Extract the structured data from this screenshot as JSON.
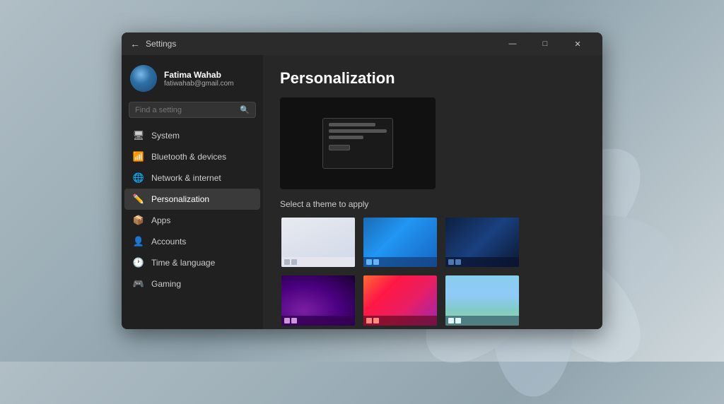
{
  "titlebar": {
    "back_label": "←",
    "title": "Settings",
    "minimize": "—",
    "maximize": "□",
    "close": "✕"
  },
  "sidebar": {
    "profile": {
      "name": "Fatima Wahab",
      "email": "fatiwahab@gmail.com"
    },
    "search": {
      "placeholder": "Find a setting"
    },
    "nav_items": [
      {
        "id": "system",
        "label": "System",
        "icon": "🖥"
      },
      {
        "id": "bluetooth",
        "label": "Bluetooth & devices",
        "icon": "📶"
      },
      {
        "id": "network",
        "label": "Network & internet",
        "icon": "🌐"
      },
      {
        "id": "personalization",
        "label": "Personalization",
        "icon": "✏️",
        "active": true
      },
      {
        "id": "apps",
        "label": "Apps",
        "icon": "📦"
      },
      {
        "id": "accounts",
        "label": "Accounts",
        "icon": "👤"
      },
      {
        "id": "time",
        "label": "Time & language",
        "icon": "🕐"
      },
      {
        "id": "gaming",
        "label": "Gaming",
        "icon": "🎮"
      }
    ]
  },
  "main": {
    "title": "Personalization",
    "section_label": "Select a theme to apply",
    "themes": [
      {
        "id": "light",
        "class": "theme-light"
      },
      {
        "id": "blue-bloom",
        "class": "theme-blue-bloom"
      },
      {
        "id": "dark-blue",
        "class": "theme-dark-blue"
      },
      {
        "id": "purple-glow",
        "class": "theme-purple-glow"
      },
      {
        "id": "flower",
        "class": "theme-flower"
      },
      {
        "id": "landscape",
        "class": "theme-landscape"
      }
    ]
  },
  "colors": {
    "accent": "#0078d4",
    "bg_dark": "#202020",
    "bg_medium": "#272727",
    "bg_light": "#2b2b2b",
    "active_item": "#3a3a3a"
  }
}
